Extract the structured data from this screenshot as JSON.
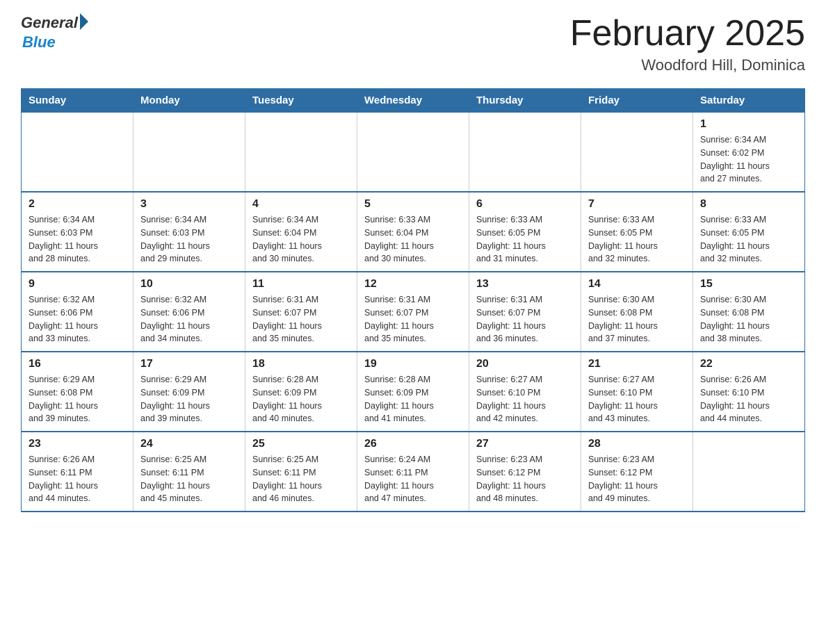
{
  "header": {
    "logo_general": "General",
    "logo_blue": "Blue",
    "month_title": "February 2025",
    "location": "Woodford Hill, Dominica"
  },
  "weekdays": [
    "Sunday",
    "Monday",
    "Tuesday",
    "Wednesday",
    "Thursday",
    "Friday",
    "Saturday"
  ],
  "weeks": [
    [
      {
        "day": "",
        "info": ""
      },
      {
        "day": "",
        "info": ""
      },
      {
        "day": "",
        "info": ""
      },
      {
        "day": "",
        "info": ""
      },
      {
        "day": "",
        "info": ""
      },
      {
        "day": "",
        "info": ""
      },
      {
        "day": "1",
        "info": "Sunrise: 6:34 AM\nSunset: 6:02 PM\nDaylight: 11 hours\nand 27 minutes."
      }
    ],
    [
      {
        "day": "2",
        "info": "Sunrise: 6:34 AM\nSunset: 6:03 PM\nDaylight: 11 hours\nand 28 minutes."
      },
      {
        "day": "3",
        "info": "Sunrise: 6:34 AM\nSunset: 6:03 PM\nDaylight: 11 hours\nand 29 minutes."
      },
      {
        "day": "4",
        "info": "Sunrise: 6:34 AM\nSunset: 6:04 PM\nDaylight: 11 hours\nand 30 minutes."
      },
      {
        "day": "5",
        "info": "Sunrise: 6:33 AM\nSunset: 6:04 PM\nDaylight: 11 hours\nand 30 minutes."
      },
      {
        "day": "6",
        "info": "Sunrise: 6:33 AM\nSunset: 6:05 PM\nDaylight: 11 hours\nand 31 minutes."
      },
      {
        "day": "7",
        "info": "Sunrise: 6:33 AM\nSunset: 6:05 PM\nDaylight: 11 hours\nand 32 minutes."
      },
      {
        "day": "8",
        "info": "Sunrise: 6:33 AM\nSunset: 6:05 PM\nDaylight: 11 hours\nand 32 minutes."
      }
    ],
    [
      {
        "day": "9",
        "info": "Sunrise: 6:32 AM\nSunset: 6:06 PM\nDaylight: 11 hours\nand 33 minutes."
      },
      {
        "day": "10",
        "info": "Sunrise: 6:32 AM\nSunset: 6:06 PM\nDaylight: 11 hours\nand 34 minutes."
      },
      {
        "day": "11",
        "info": "Sunrise: 6:31 AM\nSunset: 6:07 PM\nDaylight: 11 hours\nand 35 minutes."
      },
      {
        "day": "12",
        "info": "Sunrise: 6:31 AM\nSunset: 6:07 PM\nDaylight: 11 hours\nand 35 minutes."
      },
      {
        "day": "13",
        "info": "Sunrise: 6:31 AM\nSunset: 6:07 PM\nDaylight: 11 hours\nand 36 minutes."
      },
      {
        "day": "14",
        "info": "Sunrise: 6:30 AM\nSunset: 6:08 PM\nDaylight: 11 hours\nand 37 minutes."
      },
      {
        "day": "15",
        "info": "Sunrise: 6:30 AM\nSunset: 6:08 PM\nDaylight: 11 hours\nand 38 minutes."
      }
    ],
    [
      {
        "day": "16",
        "info": "Sunrise: 6:29 AM\nSunset: 6:08 PM\nDaylight: 11 hours\nand 39 minutes."
      },
      {
        "day": "17",
        "info": "Sunrise: 6:29 AM\nSunset: 6:09 PM\nDaylight: 11 hours\nand 39 minutes."
      },
      {
        "day": "18",
        "info": "Sunrise: 6:28 AM\nSunset: 6:09 PM\nDaylight: 11 hours\nand 40 minutes."
      },
      {
        "day": "19",
        "info": "Sunrise: 6:28 AM\nSunset: 6:09 PM\nDaylight: 11 hours\nand 41 minutes."
      },
      {
        "day": "20",
        "info": "Sunrise: 6:27 AM\nSunset: 6:10 PM\nDaylight: 11 hours\nand 42 minutes."
      },
      {
        "day": "21",
        "info": "Sunrise: 6:27 AM\nSunset: 6:10 PM\nDaylight: 11 hours\nand 43 minutes."
      },
      {
        "day": "22",
        "info": "Sunrise: 6:26 AM\nSunset: 6:10 PM\nDaylight: 11 hours\nand 44 minutes."
      }
    ],
    [
      {
        "day": "23",
        "info": "Sunrise: 6:26 AM\nSunset: 6:11 PM\nDaylight: 11 hours\nand 44 minutes."
      },
      {
        "day": "24",
        "info": "Sunrise: 6:25 AM\nSunset: 6:11 PM\nDaylight: 11 hours\nand 45 minutes."
      },
      {
        "day": "25",
        "info": "Sunrise: 6:25 AM\nSunset: 6:11 PM\nDaylight: 11 hours\nand 46 minutes."
      },
      {
        "day": "26",
        "info": "Sunrise: 6:24 AM\nSunset: 6:11 PM\nDaylight: 11 hours\nand 47 minutes."
      },
      {
        "day": "27",
        "info": "Sunrise: 6:23 AM\nSunset: 6:12 PM\nDaylight: 11 hours\nand 48 minutes."
      },
      {
        "day": "28",
        "info": "Sunrise: 6:23 AM\nSunset: 6:12 PM\nDaylight: 11 hours\nand 49 minutes."
      },
      {
        "day": "",
        "info": ""
      }
    ]
  ]
}
